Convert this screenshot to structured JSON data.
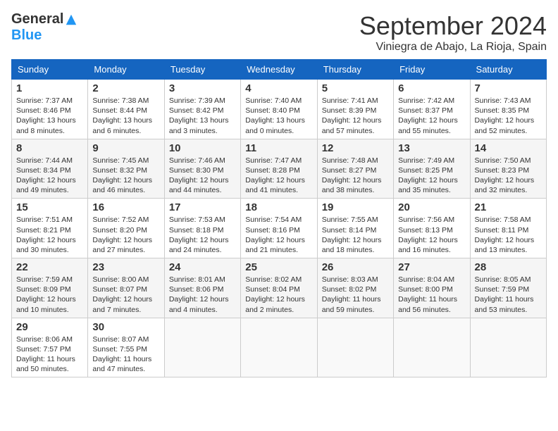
{
  "logo": {
    "general": "General",
    "blue": "Blue"
  },
  "title": "September 2024",
  "location": "Viniegra de Abajo, La Rioja, Spain",
  "days_of_week": [
    "Sunday",
    "Monday",
    "Tuesday",
    "Wednesday",
    "Thursday",
    "Friday",
    "Saturday"
  ],
  "weeks": [
    [
      {
        "day": 1,
        "sunrise": "7:37 AM",
        "sunset": "8:46 PM",
        "daylight": "13 hours and 8 minutes"
      },
      {
        "day": 2,
        "sunrise": "7:38 AM",
        "sunset": "8:44 PM",
        "daylight": "13 hours and 6 minutes"
      },
      {
        "day": 3,
        "sunrise": "7:39 AM",
        "sunset": "8:42 PM",
        "daylight": "13 hours and 3 minutes"
      },
      {
        "day": 4,
        "sunrise": "7:40 AM",
        "sunset": "8:40 PM",
        "daylight": "13 hours and 0 minutes"
      },
      {
        "day": 5,
        "sunrise": "7:41 AM",
        "sunset": "8:39 PM",
        "daylight": "12 hours and 57 minutes"
      },
      {
        "day": 6,
        "sunrise": "7:42 AM",
        "sunset": "8:37 PM",
        "daylight": "12 hours and 55 minutes"
      },
      {
        "day": 7,
        "sunrise": "7:43 AM",
        "sunset": "8:35 PM",
        "daylight": "12 hours and 52 minutes"
      }
    ],
    [
      {
        "day": 8,
        "sunrise": "7:44 AM",
        "sunset": "8:34 PM",
        "daylight": "12 hours and 49 minutes"
      },
      {
        "day": 9,
        "sunrise": "7:45 AM",
        "sunset": "8:32 PM",
        "daylight": "12 hours and 46 minutes"
      },
      {
        "day": 10,
        "sunrise": "7:46 AM",
        "sunset": "8:30 PM",
        "daylight": "12 hours and 44 minutes"
      },
      {
        "day": 11,
        "sunrise": "7:47 AM",
        "sunset": "8:28 PM",
        "daylight": "12 hours and 41 minutes"
      },
      {
        "day": 12,
        "sunrise": "7:48 AM",
        "sunset": "8:27 PM",
        "daylight": "12 hours and 38 minutes"
      },
      {
        "day": 13,
        "sunrise": "7:49 AM",
        "sunset": "8:25 PM",
        "daylight": "12 hours and 35 minutes"
      },
      {
        "day": 14,
        "sunrise": "7:50 AM",
        "sunset": "8:23 PM",
        "daylight": "12 hours and 32 minutes"
      }
    ],
    [
      {
        "day": 15,
        "sunrise": "7:51 AM",
        "sunset": "8:21 PM",
        "daylight": "12 hours and 30 minutes"
      },
      {
        "day": 16,
        "sunrise": "7:52 AM",
        "sunset": "8:20 PM",
        "daylight": "12 hours and 27 minutes"
      },
      {
        "day": 17,
        "sunrise": "7:53 AM",
        "sunset": "8:18 PM",
        "daylight": "12 hours and 24 minutes"
      },
      {
        "day": 18,
        "sunrise": "7:54 AM",
        "sunset": "8:16 PM",
        "daylight": "12 hours and 21 minutes"
      },
      {
        "day": 19,
        "sunrise": "7:55 AM",
        "sunset": "8:14 PM",
        "daylight": "12 hours and 18 minutes"
      },
      {
        "day": 20,
        "sunrise": "7:56 AM",
        "sunset": "8:13 PM",
        "daylight": "12 hours and 16 minutes"
      },
      {
        "day": 21,
        "sunrise": "7:58 AM",
        "sunset": "8:11 PM",
        "daylight": "12 hours and 13 minutes"
      }
    ],
    [
      {
        "day": 22,
        "sunrise": "7:59 AM",
        "sunset": "8:09 PM",
        "daylight": "12 hours and 10 minutes"
      },
      {
        "day": 23,
        "sunrise": "8:00 AM",
        "sunset": "8:07 PM",
        "daylight": "12 hours and 7 minutes"
      },
      {
        "day": 24,
        "sunrise": "8:01 AM",
        "sunset": "8:06 PM",
        "daylight": "12 hours and 4 minutes"
      },
      {
        "day": 25,
        "sunrise": "8:02 AM",
        "sunset": "8:04 PM",
        "daylight": "12 hours and 2 minutes"
      },
      {
        "day": 26,
        "sunrise": "8:03 AM",
        "sunset": "8:02 PM",
        "daylight": "11 hours and 59 minutes"
      },
      {
        "day": 27,
        "sunrise": "8:04 AM",
        "sunset": "8:00 PM",
        "daylight": "11 hours and 56 minutes"
      },
      {
        "day": 28,
        "sunrise": "8:05 AM",
        "sunset": "7:59 PM",
        "daylight": "11 hours and 53 minutes"
      }
    ],
    [
      {
        "day": 29,
        "sunrise": "8:06 AM",
        "sunset": "7:57 PM",
        "daylight": "11 hours and 50 minutes"
      },
      {
        "day": 30,
        "sunrise": "8:07 AM",
        "sunset": "7:55 PM",
        "daylight": "11 hours and 47 minutes"
      },
      null,
      null,
      null,
      null,
      null
    ]
  ],
  "labels": {
    "sunrise": "Sunrise:",
    "sunset": "Sunset:",
    "daylight": "Daylight:"
  }
}
